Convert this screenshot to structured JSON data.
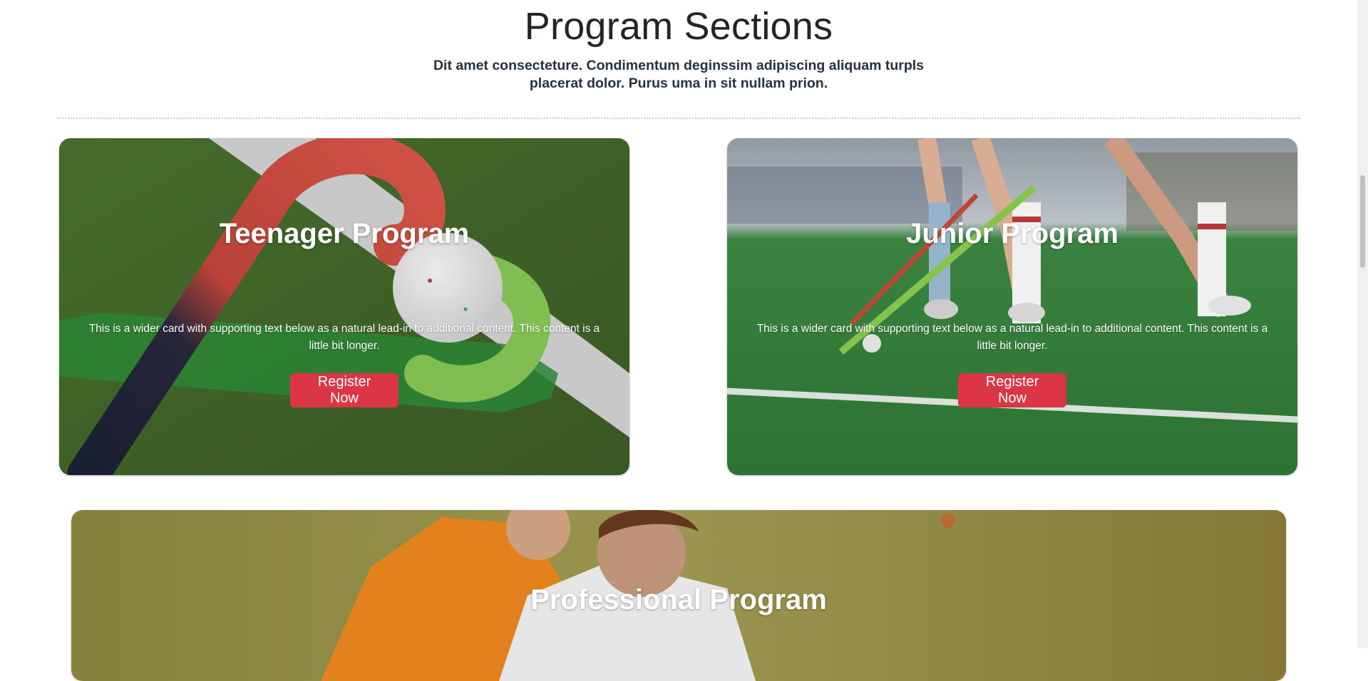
{
  "section": {
    "title": "Program Sections",
    "subtitle": "Dit amet consecteture. Condimentum deginssim adipiscing aliquam turpls placerat dolor. Purus uma in sit nullam prion."
  },
  "cards": [
    {
      "title": "Teenager Program",
      "text": "This is a wider card with supporting text below as a natural lead-in to additional content. This content is a little bit longer.",
      "button_label": "Register Now"
    },
    {
      "title": "Junior Program",
      "text": "This is a wider card with supporting text below as a natural lead-in to additional content. This content is a little bit longer.",
      "button_label": "Register Now"
    },
    {
      "title": "Professional Program"
    }
  ],
  "colors": {
    "button": "#dc3545",
    "turf": "#4f7a34",
    "heading": "#212529"
  }
}
